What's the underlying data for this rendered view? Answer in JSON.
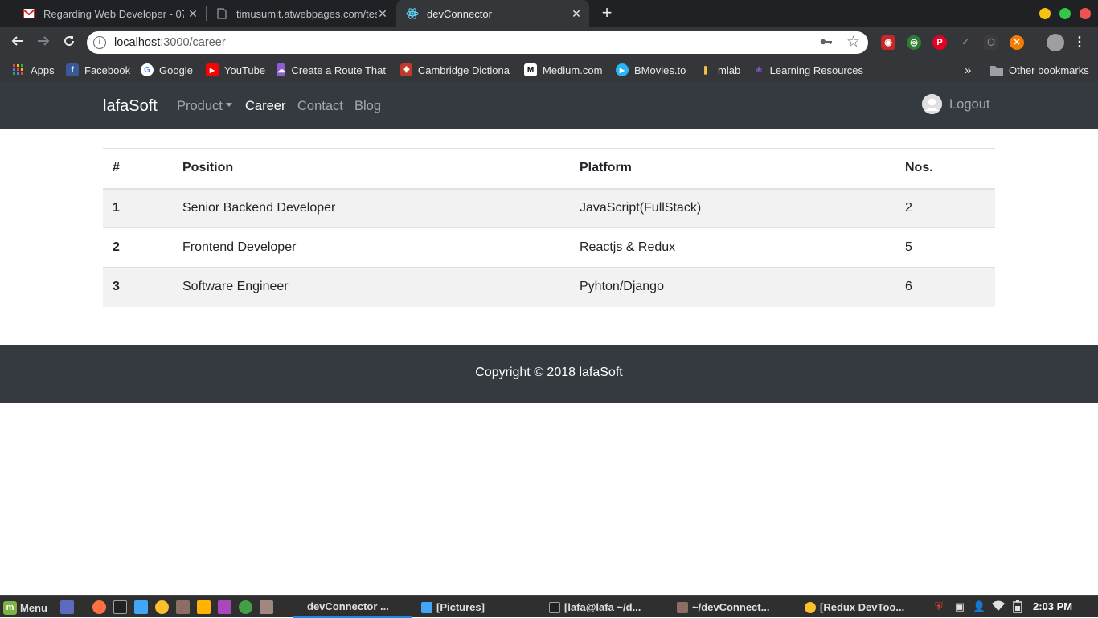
{
  "browser": {
    "tabs": [
      {
        "title": "Regarding Web Developer - 07",
        "icon": "gmail-icon"
      },
      {
        "title": "timusumit.atwebpages.com/tes",
        "icon": "page-icon"
      },
      {
        "title": "devConnector",
        "icon": "react-icon"
      }
    ],
    "url_host": "localhost",
    "url_path": ":3000/career",
    "bookmarks": [
      "Apps",
      "Facebook",
      "Google",
      "YouTube",
      "Create a Route That",
      "Cambridge Dictiona",
      "Medium.com",
      "BMovies.to",
      "mlab",
      "Learning Resources"
    ],
    "more_bookmarks": "»",
    "other_bookmarks": "Other bookmarks"
  },
  "navbar": {
    "brand": "lafaSoft",
    "links": [
      "Product",
      "Career",
      "Contact",
      "Blog"
    ],
    "logout": "Logout"
  },
  "table": {
    "headers": [
      "#",
      "Position",
      "Platform",
      "Nos."
    ],
    "rows": [
      [
        "1",
        "Senior Backend Developer",
        "JavaScript(FullStack)",
        "2"
      ],
      [
        "2",
        "Frontend Developer",
        "Reactjs & Redux",
        "5"
      ],
      [
        "3",
        "Software Engineer",
        "Pyhton/Django",
        "6"
      ]
    ]
  },
  "footer": {
    "copyright": "Copyright © 2018 lafaSoft"
  },
  "taskbar": {
    "menu": "Menu",
    "windows": [
      "devConnector ...",
      "[Pictures]",
      "[lafa@lafa ~/d...",
      "~/devConnect...",
      "[Redux DevToo..."
    ],
    "clock": "2:03 PM"
  },
  "colors": {
    "navbar_bg": "#343a40",
    "tab_active_bg": "#35363a",
    "tabstrip_bg": "#202124",
    "table_stripe": "#f2f2f2"
  }
}
